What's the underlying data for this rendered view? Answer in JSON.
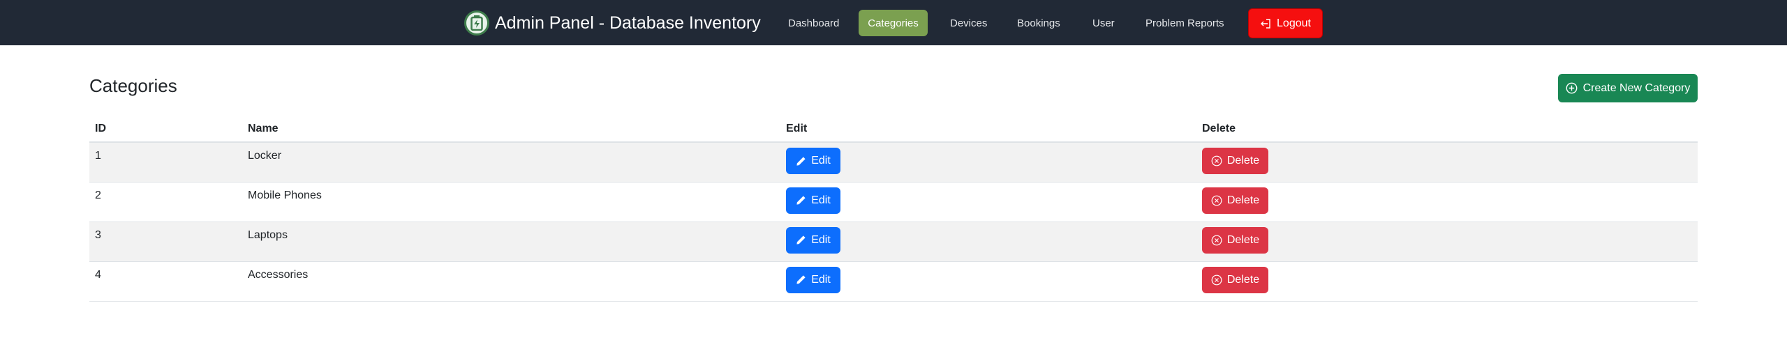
{
  "brand": {
    "title": "Admin Panel - Database Inventory",
    "logo_icon": "battery-charging-icon"
  },
  "nav": {
    "items": [
      {
        "label": "Dashboard",
        "active": false
      },
      {
        "label": "Categories",
        "active": true
      },
      {
        "label": "Devices",
        "active": false
      },
      {
        "label": "Bookings",
        "active": false
      },
      {
        "label": "User",
        "active": false
      },
      {
        "label": "Problem Reports",
        "active": false
      }
    ],
    "logout_label": "Logout"
  },
  "main": {
    "title": "Categories",
    "create_label": "Create New Category",
    "table": {
      "headers": [
        "ID",
        "Name",
        "Edit",
        "Delete"
      ],
      "edit_label": "Edit",
      "delete_label": "Delete",
      "rows": [
        {
          "id": "1",
          "name": "Locker"
        },
        {
          "id": "2",
          "name": "Mobile Phones"
        },
        {
          "id": "3",
          "name": "Laptops"
        },
        {
          "id": "4",
          "name": "Accessories"
        }
      ]
    }
  },
  "colors": {
    "navbar": "#212936",
    "active_nav": "#7ba050",
    "logout": "#f50f0f",
    "create": "#198754",
    "edit": "#0d6efd",
    "delete": "#dc3545"
  }
}
